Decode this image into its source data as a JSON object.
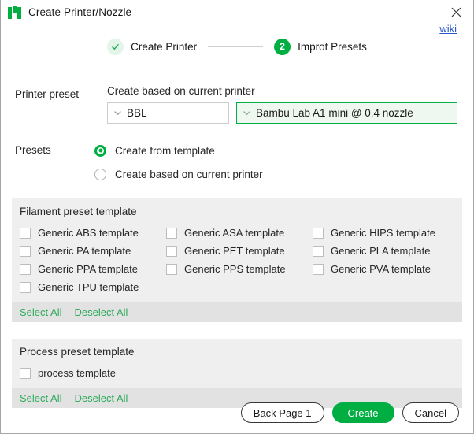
{
  "window": {
    "title": "Create Printer/Nozzle",
    "logo_icon": "bambu-logo-icon",
    "close_icon": "close-icon"
  },
  "stepper": {
    "steps": [
      {
        "label": "Create Printer",
        "marker": "check",
        "state": "done"
      },
      {
        "label": "Improt Presets",
        "marker": "2",
        "state": "active"
      }
    ],
    "wiki_link": "wiki"
  },
  "printer_preset": {
    "row_label": "Printer preset",
    "caption": "Create based on current printer",
    "vendor_select": {
      "value": "BBL",
      "chevron_icon": "chevron-down-icon"
    },
    "model_select": {
      "value": "Bambu Lab A1 mini @ 0.4 nozzle",
      "chevron_icon": "chevron-down-icon"
    }
  },
  "presets": {
    "row_label": "Presets",
    "options": [
      {
        "label": "Create from template",
        "selected": true
      },
      {
        "label": "Create based on current printer",
        "selected": false
      }
    ]
  },
  "filament_panel": {
    "title": "Filament preset template",
    "items": [
      {
        "label": "Generic ABS template",
        "checked": false
      },
      {
        "label": "Generic ASA template",
        "checked": false
      },
      {
        "label": "Generic HIPS template",
        "checked": false
      },
      {
        "label": "Generic PA template",
        "checked": false
      },
      {
        "label": "Generic PET template",
        "checked": false
      },
      {
        "label": "Generic PLA template",
        "checked": false
      },
      {
        "label": "Generic PPA template",
        "checked": false
      },
      {
        "label": "Generic PPS template",
        "checked": false
      },
      {
        "label": "Generic PVA template",
        "checked": false
      },
      {
        "label": "Generic TPU template",
        "checked": false
      }
    ],
    "select_all": "Select All",
    "deselect_all": "Deselect All"
  },
  "process_panel": {
    "title": "Process preset template",
    "items": [
      {
        "label": "process template",
        "checked": false
      }
    ],
    "select_all": "Select All",
    "deselect_all": "Deselect All"
  },
  "footer": {
    "back_label": "Back Page 1",
    "create_label": "Create",
    "cancel_label": "Cancel"
  },
  "colors": {
    "brand_green": "#00AE42",
    "link_blue": "#2a57c8",
    "link_green": "#2eab5c",
    "panel_bg": "#efefef",
    "panel_action_bg": "#e2e2e2"
  }
}
